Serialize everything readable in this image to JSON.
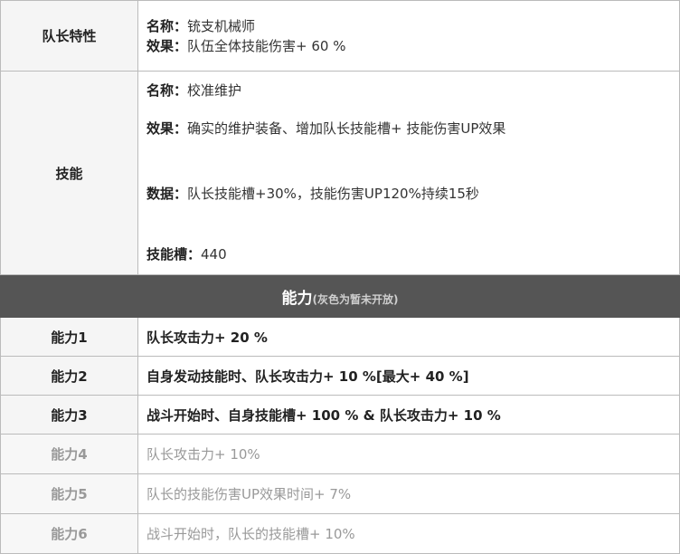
{
  "captain": {
    "label": "队长特性",
    "name_key": "名称：",
    "name_value": "铳支机械师",
    "effect_key": "效果：",
    "effect_value": "队伍全体技能伤害+ 60 %"
  },
  "skill": {
    "label": "技能",
    "name_key": "名称：",
    "name_value": "校准维护",
    "effect_key": "效果：",
    "effect_value": "确实的维护装备、增加队长技能槽+ 技能伤害UP效果",
    "data_key": "数据：",
    "data_value": "队长技能槽+30%，技能伤害UP120%持续15秒",
    "slot_key": "技能槽：",
    "slot_value": "440"
  },
  "abilities_header": {
    "title": "能力",
    "subtitle": "(灰色为暂未开放)"
  },
  "abilities": [
    {
      "label": "能力1",
      "text": "队长攻击力+ 20 %"
    },
    {
      "label": "能力2",
      "text": "自身发动技能时、队长攻击力+ 10 %[最大+ 40 %]"
    },
    {
      "label": "能力3",
      "text": "战斗开始时、自身技能槽+ 100 % & 队长攻击力+ 10 %"
    },
    {
      "label": "能力4",
      "text": "队长攻击力+ 10%"
    },
    {
      "label": "能力5",
      "text": "队长的技能伤害UP效果时间+ 7%"
    },
    {
      "label": "能力6",
      "text": "战斗开始时，队长的技能槽+ 10%"
    }
  ]
}
